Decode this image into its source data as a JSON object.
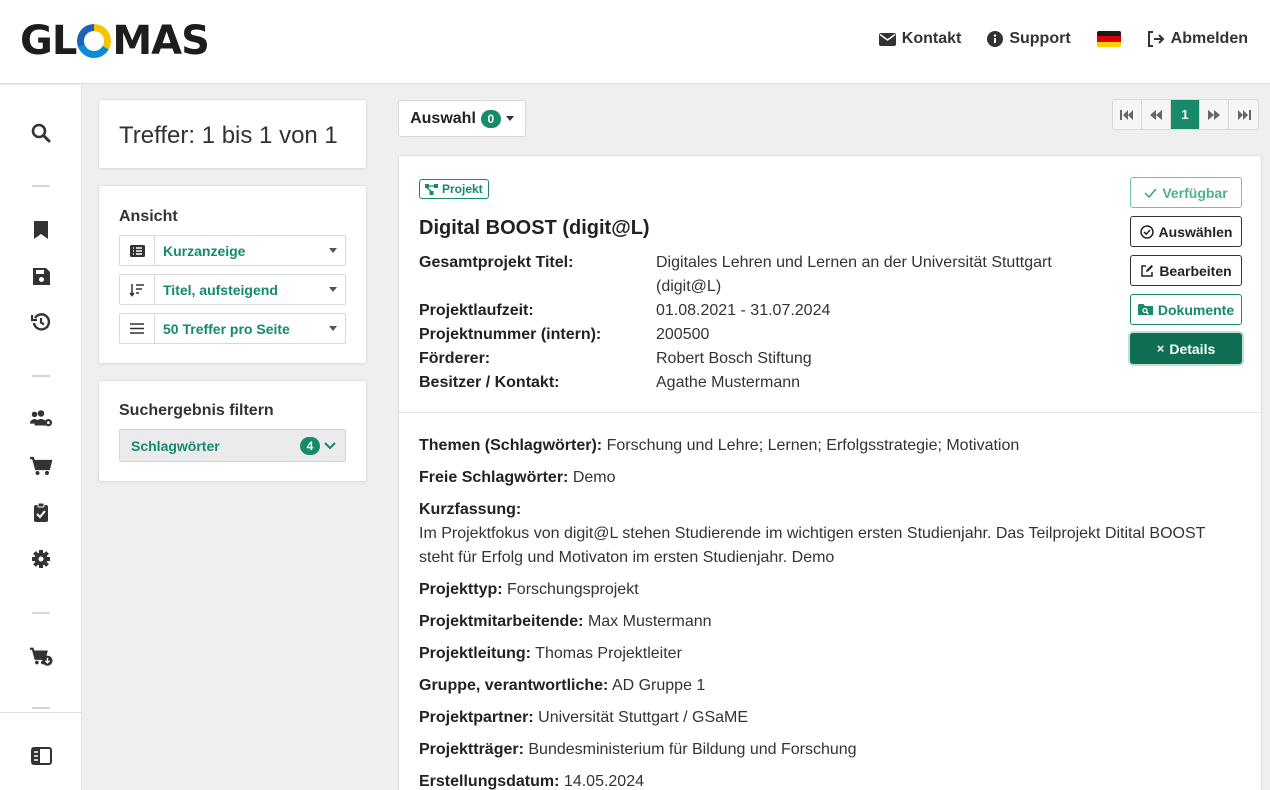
{
  "header": {
    "logo": "GLOMAS",
    "nav": {
      "contact": "Kontakt",
      "support": "Support",
      "logout": "Abmelden"
    }
  },
  "results": {
    "hits": "Treffer: 1 bis 1 von 1"
  },
  "view": {
    "title": "Ansicht",
    "display_mode": "Kurzanzeige",
    "sort_order": "Titel, aufsteigend",
    "per_page": "50 Treffer pro Seite"
  },
  "filter": {
    "title": "Suchergebnis filtern",
    "keywords_label": "Schlagwörter",
    "keywords_count": "4"
  },
  "toolbar": {
    "selection_label": "Auswahl",
    "selection_count": "0"
  },
  "pagination": {
    "current_page": "1"
  },
  "project": {
    "kind": "Projekt",
    "title": "Digital BOOST (digit@L)",
    "info": [
      {
        "label": "Gesamtprojekt Titel:",
        "value": "Digitales Lehren und Lernen an der Universität Stuttgart (digit@L)"
      },
      {
        "label": "Projektlaufzeit:",
        "value": "01.08.2021 - 31.07.2024"
      },
      {
        "label": "Projektnummer (intern):",
        "value": "200500"
      },
      {
        "label": "Förderer:",
        "value": "Robert Bosch Stiftung"
      },
      {
        "label": "Besitzer / Kontakt:",
        "value": "Agathe Mustermann"
      }
    ],
    "actions": {
      "available": "Verfügbar",
      "select": "Auswählen",
      "edit": "Bearbeiten",
      "documents": "Dokumente",
      "details": "Details"
    },
    "fields": [
      {
        "label": "Themen (Schlagwörter):",
        "value": "Forschung und Lehre; Lernen; Erfolgsstrategie; Motivation"
      },
      {
        "label": "Freie Schlagwörter:",
        "value": "Demo"
      },
      {
        "label": "Kurzfassung:",
        "value": "Im Projektfokus von digit@L stehen Studierende im wichtigen ersten Studienjahr. Das Teilprojekt Ditital BOOST steht für Erfolg und Motivaton im ersten Studienjahr. Demo"
      },
      {
        "label": "Projekttyp:",
        "value": "Forschungsprojekt"
      },
      {
        "label": "Projektmitarbeitende:",
        "value": "Max Mustermann"
      },
      {
        "label": "Projektleitung:",
        "value": "Thomas Projektleiter"
      },
      {
        "label": "Gruppe, verantwortliche:",
        "value": "AD Gruppe 1"
      },
      {
        "label": "Projektpartner:",
        "value": "Universität Stuttgart / GSaME"
      },
      {
        "label": "Projektträger:",
        "value": "Bundesministerium für Bildung und Forschung"
      },
      {
        "label": "Erstellungsdatum:",
        "value": "14.05.2024"
      }
    ]
  },
  "colors": {
    "accent": "#178a6a",
    "accent_dark": "#0f6e54",
    "accent_text": "#138a6e"
  }
}
